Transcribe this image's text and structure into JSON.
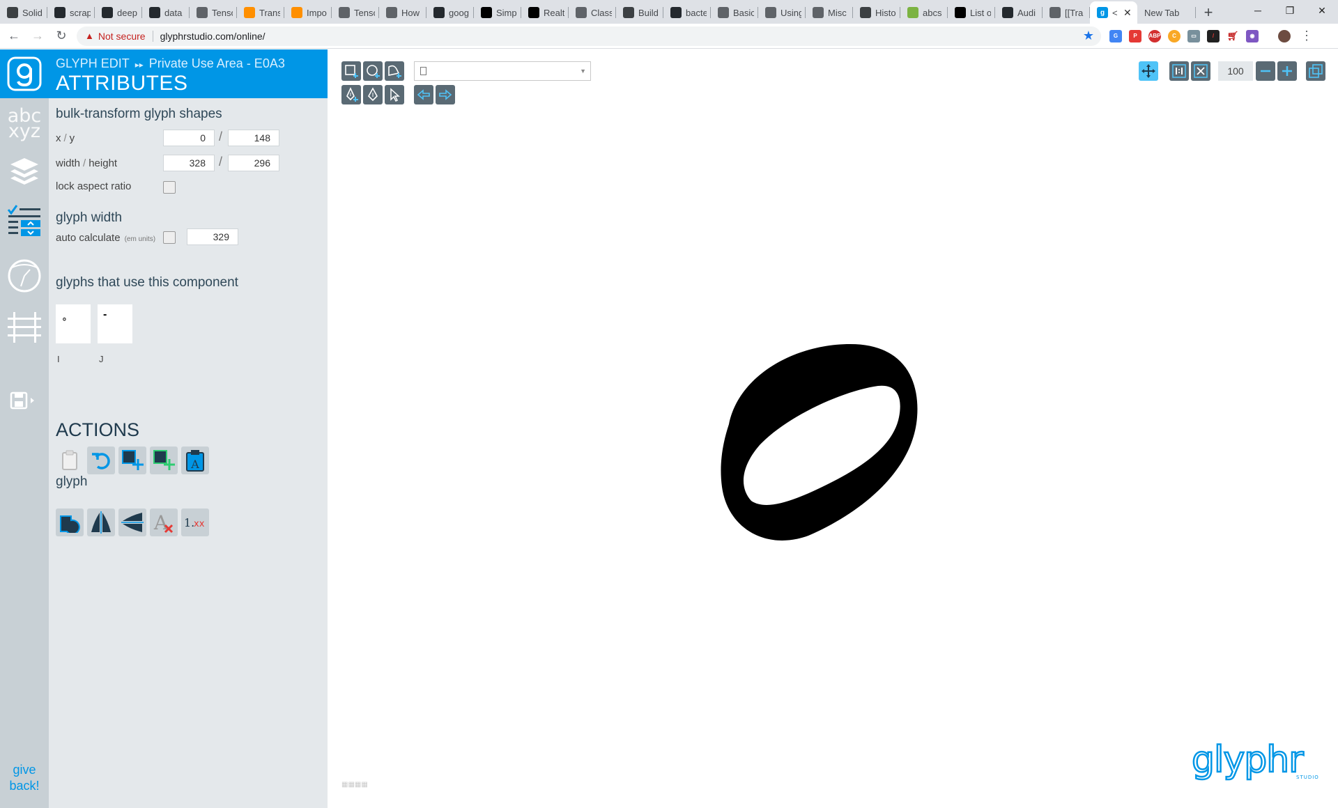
{
  "browser": {
    "tabs": [
      {
        "title": "Solid",
        "icon": "doc-icon",
        "color": "#3c4043"
      },
      {
        "title": "scrap",
        "icon": "github-icon",
        "color": "#24292e"
      },
      {
        "title": "deep",
        "icon": "github-icon",
        "color": "#24292e"
      },
      {
        "title": "data",
        "icon": "github-icon",
        "color": "#24292e"
      },
      {
        "title": "Tenso",
        "icon": "globe-icon",
        "color": "#5f6368"
      },
      {
        "title": "Trans",
        "icon": "tensorflow-icon",
        "color": "#ff8f00"
      },
      {
        "title": "Impo",
        "icon": "tensorflow-icon",
        "color": "#ff8f00"
      },
      {
        "title": "Tenso",
        "icon": "code-icon",
        "color": "#5f6368"
      },
      {
        "title": "How",
        "icon": "globe-icon",
        "color": "#5f6368"
      },
      {
        "title": "goog",
        "icon": "github-icon",
        "color": "#24292e"
      },
      {
        "title": "Simp",
        "icon": "medium-icon",
        "color": "#000000"
      },
      {
        "title": "Realt",
        "icon": "medium-icon",
        "color": "#000000"
      },
      {
        "title": "Class",
        "icon": "globe-icon",
        "color": "#5f6368"
      },
      {
        "title": "Build",
        "icon": "doc-icon",
        "color": "#3c4043"
      },
      {
        "title": "bacte",
        "icon": "github-icon",
        "color": "#24292e"
      },
      {
        "title": "Basic",
        "icon": "edge-icon",
        "color": "#5f6368"
      },
      {
        "title": "Using",
        "icon": "edge-icon",
        "color": "#5f6368"
      },
      {
        "title": "Misc",
        "icon": "globe-icon",
        "color": "#5f6368"
      },
      {
        "title": "Histo",
        "icon": "doc-icon",
        "color": "#3c4043"
      },
      {
        "title": "abcs",
        "icon": "pencil-icon",
        "color": "#7cb342"
      },
      {
        "title": "List o",
        "icon": "wikipedia-icon",
        "color": "#000000"
      },
      {
        "title": "Audi",
        "icon": "github-icon",
        "color": "#24292e"
      },
      {
        "title": "[[Tra",
        "icon": "arrow-icon",
        "color": "#5f6368"
      }
    ],
    "active_tab": {
      "title": "<",
      "icon": "glyphr-icon",
      "color": "#0096e6"
    },
    "new_tab_title": "New Tab",
    "not_secure": "Not secure",
    "url": "glyphrstudio.com/online/"
  },
  "leftnav": {
    "give_back": [
      "give",
      "back!"
    ],
    "icons": [
      "abcxyz-icon",
      "layers-icon",
      "attributes-icon",
      "guides-icon",
      "grid-icon",
      "save-icon"
    ]
  },
  "panel": {
    "breadcrumb_mode": "GLYPH EDIT",
    "breadcrumb_item": "Private Use Area - E0A3",
    "title": "ATTRIBUTES",
    "bulk_transform": "bulk-transform glyph shapes",
    "xy_label_x": "x",
    "xy_label_y": "y",
    "x_value": "0",
    "y_value": "148",
    "wh_label_w": "width",
    "wh_label_h": "height",
    "width_value": "328",
    "height_value": "296",
    "lock_aspect": "lock aspect ratio",
    "glyph_width_heading": "glyph width",
    "auto_calculate": "auto calculate",
    "em_units": "(em units)",
    "glyph_width_value": "329",
    "component_heading": "glyphs that use this component",
    "component_glyphs": [
      {
        "label": "I",
        "preview": "∘"
      },
      {
        "label": "J",
        "preview": "-"
      }
    ],
    "actions_heading": "ACTIONS",
    "glyph_heading": "glyph"
  },
  "canvas": {
    "zoom": "100",
    "accent": "#0096e6",
    "brand": "glyphr",
    "brand_sub": "STUDIO"
  }
}
